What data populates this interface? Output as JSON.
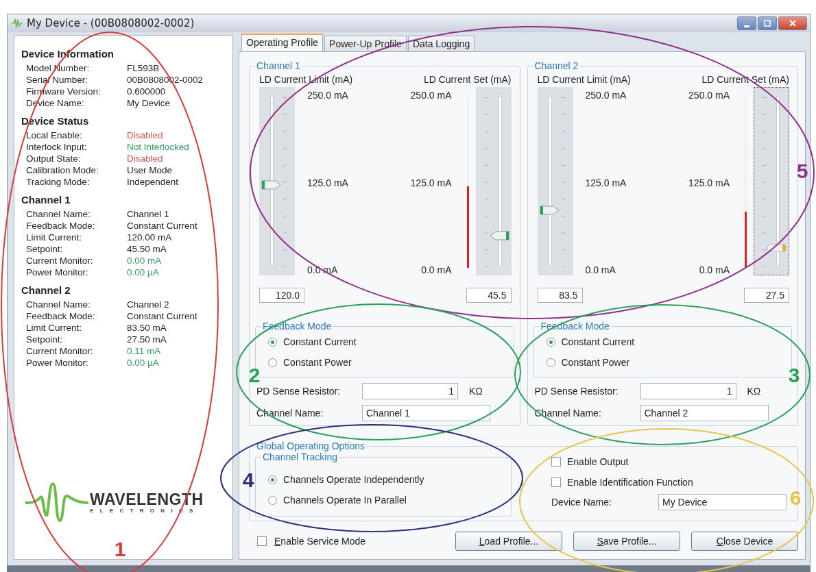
{
  "window": {
    "title": "My Device - (00B0808002-0002)"
  },
  "info_panel": {
    "sections": [
      {
        "heading": "Device Information",
        "rows": [
          {
            "label": "Model Number:",
            "value": "FL593B",
            "color": "#222222"
          },
          {
            "label": "Serial Number:",
            "value": "00B0808002-0002",
            "color": "#222222"
          },
          {
            "label": "Firmware Version:",
            "value": "0.600000",
            "color": "#222222"
          },
          {
            "label": "Device Name:",
            "value": "My Device",
            "color": "#222222"
          }
        ]
      },
      {
        "heading": "Device Status",
        "rows": [
          {
            "label": "Local Enable:",
            "value": "Disabled",
            "color": "#d9534f"
          },
          {
            "label": "Interlock Input:",
            "value": "Not Interlocked",
            "color": "#2e9e5b"
          },
          {
            "label": "Output State:",
            "value": "Disabled",
            "color": "#d9534f"
          },
          {
            "label": "Calibration Mode:",
            "value": "User Mode",
            "color": "#222222"
          },
          {
            "label": "Tracking Mode:",
            "value": "Independent",
            "color": "#222222"
          }
        ]
      },
      {
        "heading": "Channel 1",
        "rows": [
          {
            "label": "Channel Name:",
            "value": "Channel 1",
            "color": "#222222"
          },
          {
            "label": "Feedback Mode:",
            "value": "Constant Current",
            "color": "#222222"
          },
          {
            "label": "Limit Current:",
            "value": "120.00 mA",
            "color": "#222222"
          },
          {
            "label": "Setpoint:",
            "value": "45.50 mA",
            "color": "#222222"
          },
          {
            "label": "Current Monitor:",
            "value": "0.00 mA",
            "color": "#2e9e5b"
          },
          {
            "label": "Power Monitor:",
            "value": "0.00 µA",
            "color": "#2e9e5b"
          }
        ]
      },
      {
        "heading": "Channel 2",
        "rows": [
          {
            "label": "Channel Name:",
            "value": "Channel 2",
            "color": "#222222"
          },
          {
            "label": "Feedback Mode:",
            "value": "Constant Current",
            "color": "#222222"
          },
          {
            "label": "Limit Current:",
            "value": "83.50 mA",
            "color": "#222222"
          },
          {
            "label": "Setpoint:",
            "value": "27.50 mA",
            "color": "#222222"
          },
          {
            "label": "Current Monitor:",
            "value": "0.11 mA",
            "color": "#2e9e5b"
          },
          {
            "label": "Power Monitor:",
            "value": "0.00 µA",
            "color": "#2e9e5b"
          }
        ]
      }
    ],
    "logo": {
      "name": "WAVELENGTH",
      "subtitle": "ELECTRONICS"
    }
  },
  "tabs": [
    {
      "label": "Operating Profile",
      "selected": true
    },
    {
      "label": "Power-Up Profile",
      "selected": false
    },
    {
      "label": "Data Logging",
      "selected": false
    }
  ],
  "channels": [
    {
      "title": "Channel 1",
      "sliders": [
        {
          "kind": "limit",
          "label": "LD Current Limit (mA)",
          "level": 0.48,
          "value": "120.0",
          "focused": false,
          "scale": [
            "250.0 mA",
            "125.0 mA",
            "0.0 mA"
          ]
        },
        {
          "kind": "set",
          "label": "LD Current Set (mA)",
          "level": 0.182,
          "value": "45.5",
          "focused": false,
          "scale": [
            "250.0 mA",
            "125.0 mA",
            "0.0 mA"
          ]
        }
      ],
      "feedback": {
        "title": "Feedback Mode",
        "options": [
          {
            "label": "Constant Current",
            "selected": true
          },
          {
            "label": "Constant Power",
            "selected": false
          }
        ],
        "resistor_label": "PD Sense Resistor:",
        "resistor_value": "1",
        "resistor_unit": "KΩ",
        "name_label": "Channel Name:",
        "name_value": "Channel 1"
      }
    },
    {
      "title": "Channel 2",
      "sliders": [
        {
          "kind": "limit",
          "label": "LD Current Limit (mA)",
          "level": 0.334,
          "value": "83.5",
          "focused": false,
          "scale": [
            "250.0 mA",
            "125.0 mA",
            "0.0 mA"
          ]
        },
        {
          "kind": "set",
          "label": "LD Current Set (mA)",
          "level": 0.11,
          "value": "27.5",
          "focused": true,
          "scale": [
            "250.0 mA",
            "125.0 mA",
            "0.0 mA"
          ]
        }
      ],
      "feedback": {
        "title": "Feedback Mode",
        "options": [
          {
            "label": "Constant Current",
            "selected": true
          },
          {
            "label": "Constant Power",
            "selected": false
          }
        ],
        "resistor_label": "PD Sense Resistor:",
        "resistor_value": "1",
        "resistor_unit": "KΩ",
        "name_label": "Channel Name:",
        "name_value": "Channel 2"
      }
    }
  ],
  "global_options": {
    "title": "Global Operating Options",
    "tracking": {
      "title": "Channel Tracking",
      "options": [
        {
          "label": "Channels Operate Independently",
          "selected": true
        },
        {
          "label": "Channels Operate In Parallel",
          "selected": false
        }
      ]
    },
    "checkboxes": [
      {
        "label": "Enable Output",
        "checked": false
      },
      {
        "label": "Enable Identification Function",
        "checked": false
      }
    ],
    "device_name_label": "Device Name:",
    "device_name_value": "My Device"
  },
  "service_mode": {
    "label": "Enable Service Mode",
    "checked": false
  },
  "buttons": [
    "Load Profile...",
    "Save Profile...",
    "Close Device"
  ],
  "annotations": [
    {
      "number": "1",
      "color": "#d93a3a"
    },
    {
      "number": "5",
      "color": "#8e2f8e"
    },
    {
      "number": "2",
      "color": "#2aa05a"
    },
    {
      "number": "3",
      "color": "#2aa05a"
    },
    {
      "number": "4",
      "color": "#2c2f7a"
    },
    {
      "number": "6",
      "color": "#e6c54a"
    }
  ]
}
